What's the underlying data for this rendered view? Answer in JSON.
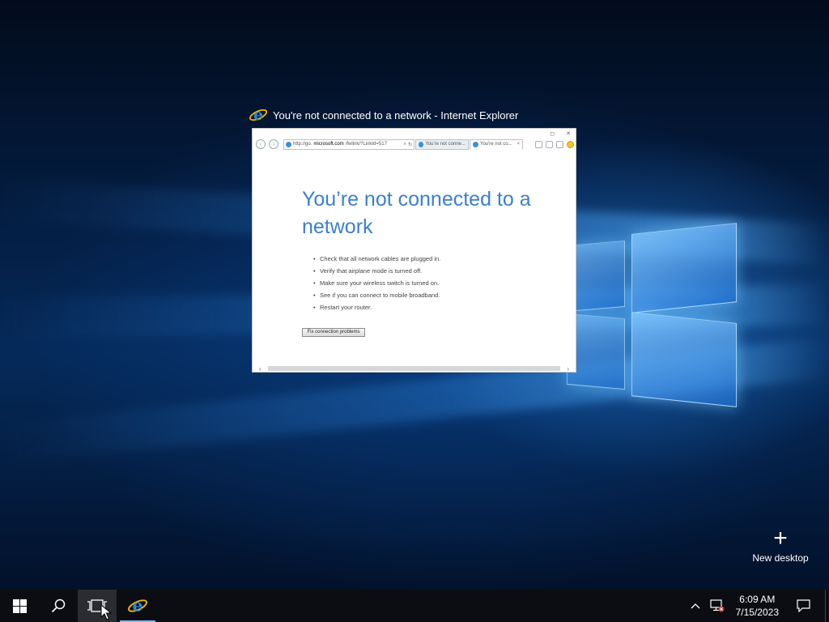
{
  "window": {
    "caption": "You're not connected to a network - Internet Explorer",
    "icon": "ie-icon"
  },
  "browser": {
    "address": {
      "prefix": "http://go.",
      "domain": "microsoft.com",
      "suffix": "/fwlink/?LinkId=517"
    },
    "tabs": [
      {
        "label": "You're not conne...",
        "active": false
      },
      {
        "label": "You're not co...",
        "active": true
      }
    ],
    "tab_close": "×"
  },
  "page": {
    "title": "You’re not connected to a network",
    "bullets": [
      "Check that all network cables are plugged in.",
      "Verify that airplane mode is turned off.",
      "Make sure your wireless switch is turned on.",
      "See if you can connect to mobile broadband.",
      "Restart your router."
    ],
    "fix_button": "Fix connection problems"
  },
  "task_view": {
    "new_desktop": "New desktop",
    "plus": "+"
  },
  "taskbar": {
    "start_icon": "windows-start-icon",
    "search_icon": "search-icon",
    "task_view_icon": "task-view-icon",
    "pinned_app_icon": "ie-icon"
  },
  "tray": {
    "chevron": "^",
    "network_icon": "network-disconnected-icon",
    "time": "6:09 AM",
    "date": "7/15/2023",
    "notification_icon": "action-center-icon"
  },
  "colors": {
    "link_blue": "#3b7fd1",
    "taskbar": "#0b0d12",
    "wallpaper": "#031632"
  }
}
